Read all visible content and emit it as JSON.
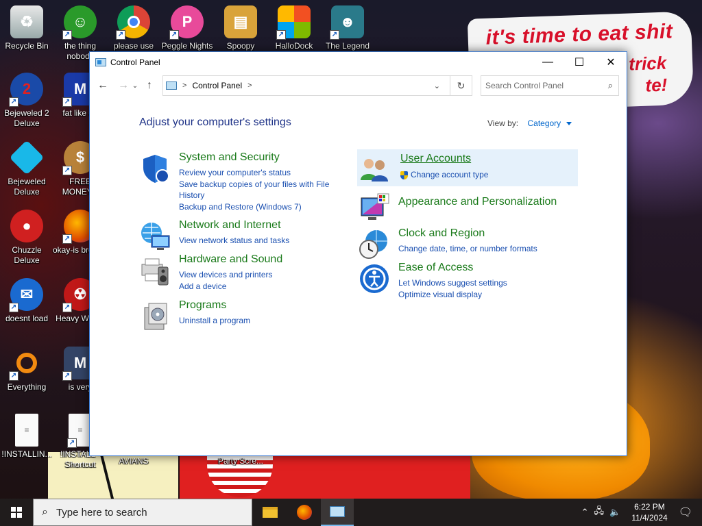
{
  "desktop": {
    "banner_line1": "it's time to eat shit",
    "banner_line2": "trick",
    "banner_line3": "te!",
    "icons": [
      {
        "label": "Recycle Bin"
      },
      {
        "label": "the thing nobody"
      },
      {
        "label": "please use"
      },
      {
        "label": "Peggle Nights"
      },
      {
        "label": "Spoopy"
      },
      {
        "label": "HalloDock"
      },
      {
        "label": "The Legend"
      },
      {
        "label": "Bejeweled 2 Deluxe"
      },
      {
        "label": "fat like da"
      },
      {
        "label": "Bejeweled Deluxe"
      },
      {
        "label": "FREE MONEY.e"
      },
      {
        "label": "Chuzzle Deluxe"
      },
      {
        "label": "okay-is browse"
      },
      {
        "label": "doesnt load"
      },
      {
        "label": "Heavy Weap."
      },
      {
        "label": "Everything"
      },
      {
        "label": "is very"
      },
      {
        "label": "!INSTALLIN..."
      },
      {
        "label": "!INSTALL - Shortcut"
      },
      {
        "label": "AVIANS"
      },
      {
        "label": "Party Scre..."
      }
    ]
  },
  "window": {
    "title": "Control Panel",
    "minimize": "—",
    "maximize": "☐",
    "close": "✕",
    "address": {
      "crumb": "Control Panel",
      "separator": ">",
      "trailing_separator": ">"
    },
    "search": {
      "placeholder": "Search Control Panel"
    },
    "heading": "Adjust your computer's settings",
    "view_by_label": "View by:",
    "view_by_value": "Category",
    "categories_left": [
      {
        "title": "System and Security",
        "links": [
          "Review your computer's status",
          "Save backup copies of your files with File History",
          "Backup and Restore (Windows 7)"
        ]
      },
      {
        "title": "Network and Internet",
        "links": [
          "View network status and tasks"
        ]
      },
      {
        "title": "Hardware and Sound",
        "links": [
          "View devices and printers",
          "Add a device"
        ]
      },
      {
        "title": "Programs",
        "links": [
          "Uninstall a program"
        ]
      }
    ],
    "categories_right": [
      {
        "title": "User Accounts",
        "links": [
          "Change account type"
        ]
      },
      {
        "title": "Appearance and Personalization",
        "links": []
      },
      {
        "title": "Clock and Region",
        "links": [
          "Change date, time, or number formats"
        ]
      },
      {
        "title": "Ease of Access",
        "links": [
          "Let Windows suggest settings",
          "Optimize visual display"
        ]
      }
    ]
  },
  "taskbar": {
    "search_placeholder": "Type here to search",
    "time": "6:22 PM",
    "date": "11/4/2024"
  },
  "colors": {
    "accent": "#0066cc",
    "category_title": "#1a7a1a",
    "link": "#1a4fb0",
    "heading": "#1e3287"
  }
}
